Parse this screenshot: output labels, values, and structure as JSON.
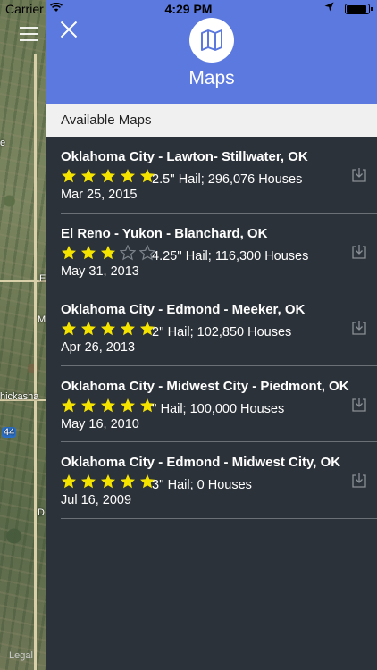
{
  "status_bar": {
    "carrier": "Carrier",
    "time": "4:29 PM",
    "battery_level": 0.95
  },
  "map_background": {
    "labels": [
      "e",
      "E",
      "M",
      "hickasha",
      "44",
      "D"
    ],
    "legal": "Legal"
  },
  "header": {
    "title": "Maps",
    "icon": "map-icon",
    "accent_color": "#5b79de"
  },
  "section": {
    "title": "Available Maps"
  },
  "maps": [
    {
      "title": "Oklahoma City - Lawton- Stillwater, OK",
      "rating": 5,
      "detail": "2.5'' Hail; 296,076 Houses",
      "date": "Mar 25, 2015"
    },
    {
      "title": "El Reno - Yukon - Blanchard, OK",
      "rating": 3,
      "detail": "4.25'' Hail; 116,300 Houses",
      "date": "May 31, 2013"
    },
    {
      "title": "Oklahoma City - Edmond - Meeker, OK",
      "rating": 5,
      "detail": "2'' Hail; 102,850 Houses",
      "date": "Apr 26, 2013"
    },
    {
      "title": "Oklahoma City - Midwest City - Piedmont, OK",
      "rating": 5,
      "detail": "'' Hail; 100,000 Houses",
      "date": "May 16, 2010"
    },
    {
      "title": "Oklahoma City - Edmond - Midwest City, OK",
      "rating": 5,
      "detail": "3'' Hail; 0 Houses",
      "date": "Jul 16, 2009"
    }
  ],
  "colors": {
    "star_filled": "#f5e400",
    "drawer_bg": "#2c3239"
  }
}
